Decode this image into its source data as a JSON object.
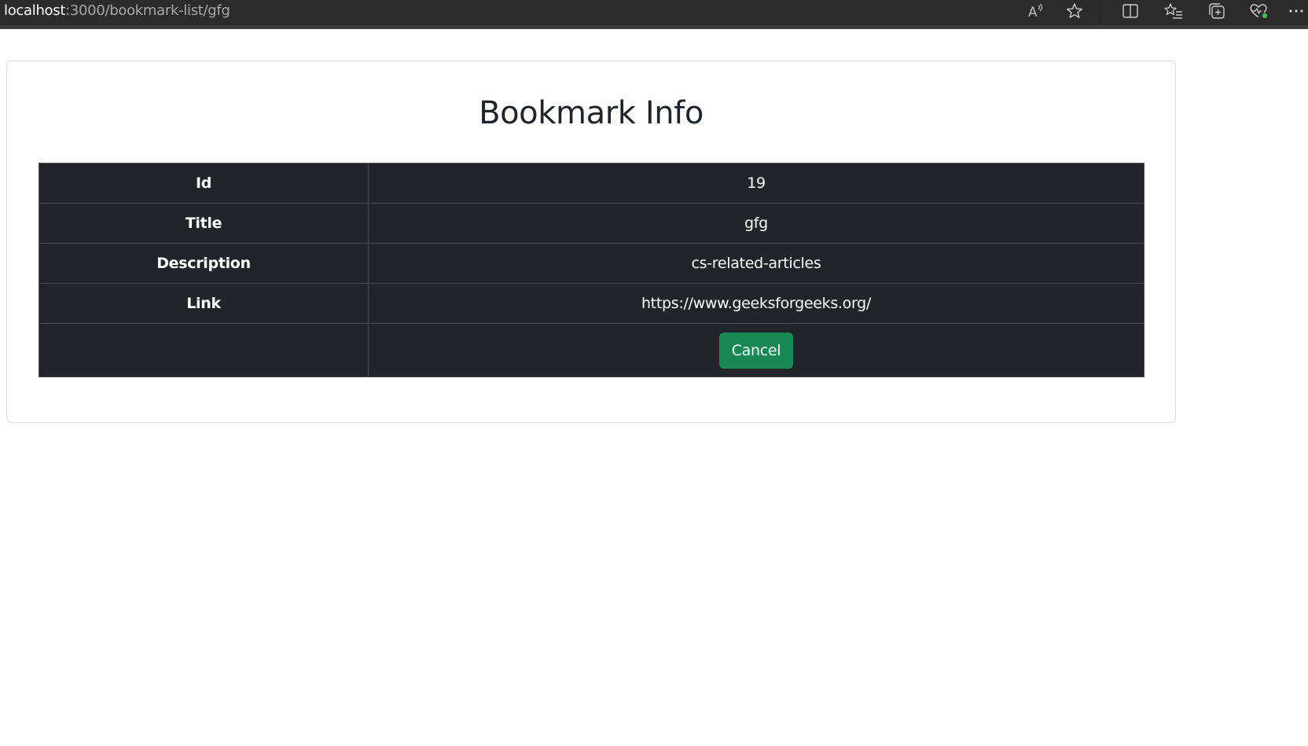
{
  "browser": {
    "url_host": "localhost",
    "url_path": ":3000/bookmark-list/gfg",
    "toolbar_icons": [
      "read-aloud-icon",
      "favorite-star-icon",
      "split-screen-icon",
      "favorites-list-icon",
      "collections-icon",
      "browser-essentials-icon",
      "more-options-icon"
    ]
  },
  "page": {
    "title": "Bookmark Info"
  },
  "bookmark": {
    "rows": [
      {
        "label": "Id",
        "value": "19"
      },
      {
        "label": "Title",
        "value": "gfg"
      },
      {
        "label": "Description",
        "value": "cs-related-articles"
      },
      {
        "label": "Link",
        "value": "https://www.geeksforgeeks.org/"
      }
    ],
    "cancel_label": "Cancel"
  },
  "colors": {
    "table_background": "#212529",
    "button_success": "#198754",
    "browser_toolbar": "#2b2b2b"
  }
}
